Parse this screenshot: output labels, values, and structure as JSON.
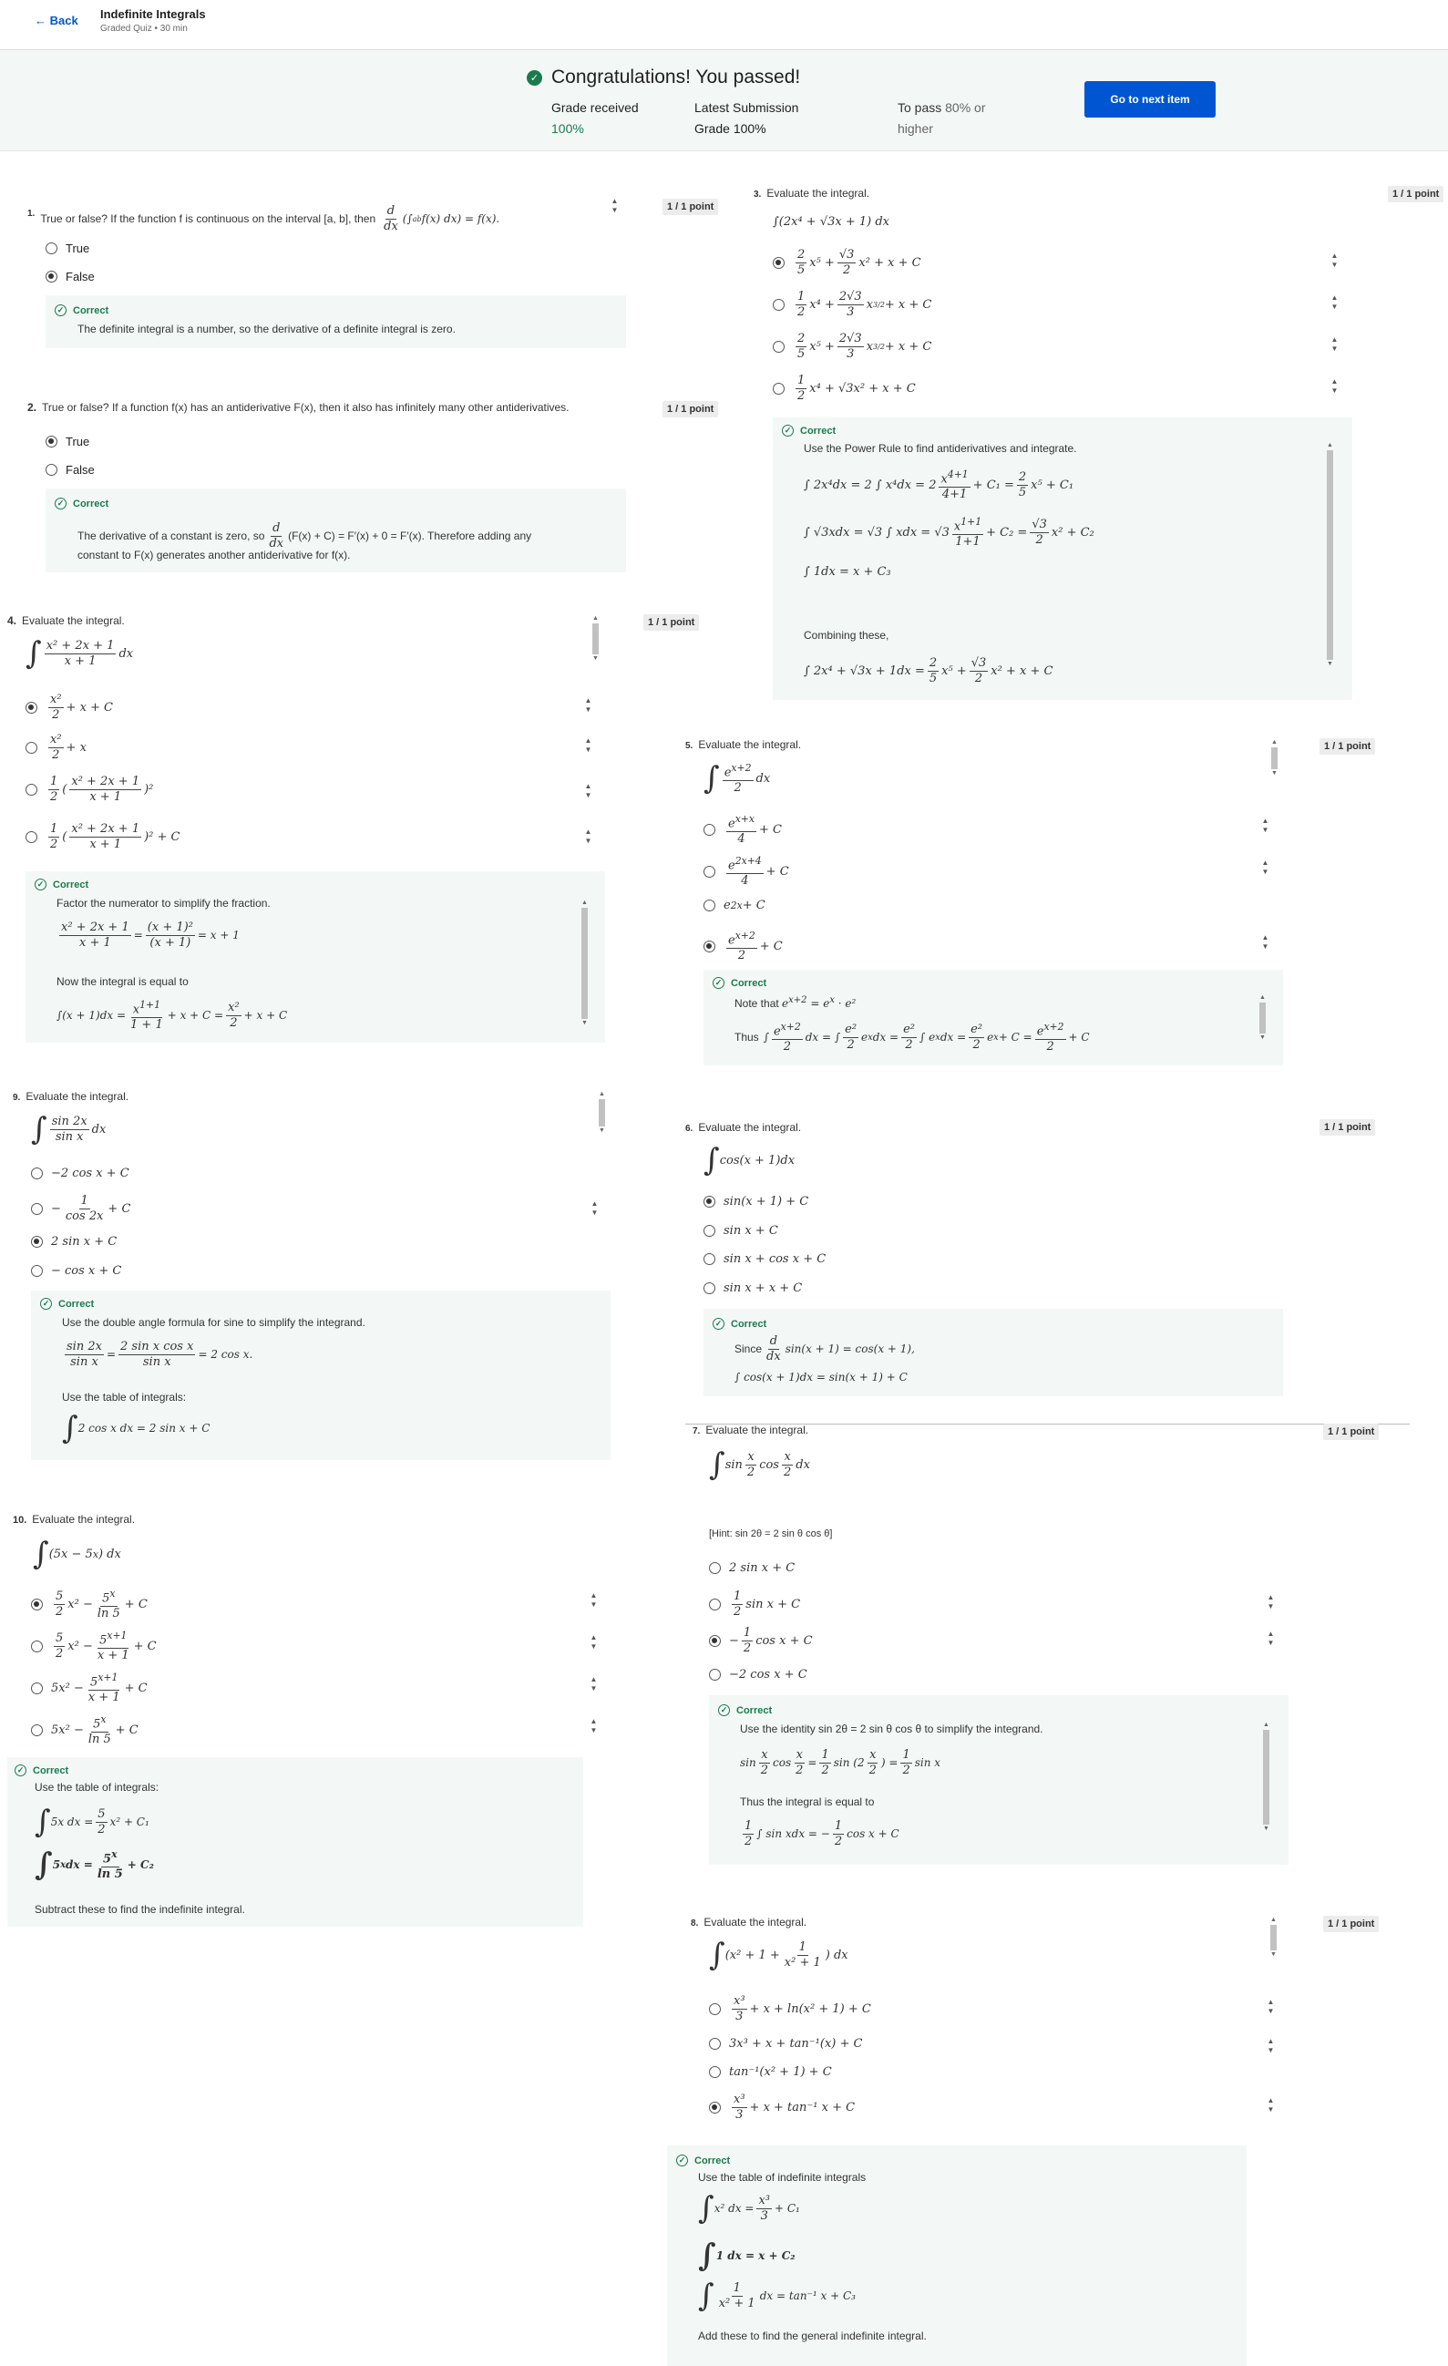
{
  "header": {
    "back_label": "Back",
    "title": "Indefinite Integrals",
    "subtitle": "Graded Quiz • 30 min"
  },
  "banner": {
    "title": "Congratulations! You passed!",
    "grade_label": "Grade received",
    "grade_value": "100%",
    "latest_label": "Latest Submission Grade",
    "latest_value": "100%",
    "topass_label": "To pass",
    "topass_value": "80% or higher",
    "next_button": "Go to next item"
  },
  "common": {
    "points": "1 / 1 point",
    "correct": "Correct",
    "evaluate": "Evaluate the integral."
  },
  "q1": {
    "num": "1.",
    "text": "True or false? If the function f is continuous on the interval [a, b], then",
    "options": [
      "True",
      "False"
    ],
    "selected": 1,
    "feedback": "The definite integral is a number, so the derivative of a definite integral is zero."
  },
  "q2": {
    "num": "2.",
    "text": "True or false? If a function f(x) has an antiderivative F(x), then it also has infinitely many other antiderivatives.",
    "options": [
      "True",
      "False"
    ],
    "selected": 0,
    "feedback_a": "The derivative of a constant is zero, so",
    "feedback_b": "(F(x) + C) = F′(x) + 0 = F′(x). Therefore adding any",
    "feedback_c": "constant to F(x) generates another antiderivative for f(x)."
  },
  "q3": {
    "num": "3.",
    "feedback": "Use the Power Rule to find antiderivatives and integrate.",
    "combining": "Combining these,"
  },
  "q4": {
    "num": "4.",
    "feedback": "Factor the numerator to simplify the fraction.",
    "feedback2": "Now the integral is equal to"
  },
  "q5": {
    "num": "5.",
    "feedback_note": "Note that",
    "feedback_thus": "Thus"
  },
  "q6": {
    "num": "6.",
    "feedback_since": "Since"
  },
  "q7": {
    "num": "7.",
    "hint": "[Hint: sin 2θ = 2 sin θ cos θ]",
    "feedback": "Use the identity sin 2θ = 2 sin θ cos θ to simplify the integrand.",
    "feedback2": "Thus the integral is equal to"
  },
  "q8": {
    "num": "8.",
    "feedback": "Use the table of indefinite integrals",
    "feedback2": "Add these to find the general indefinite integral."
  },
  "q9": {
    "num": "9.",
    "feedback": "Use the double angle formula for sine to simplify the integrand.",
    "feedback2": "Use the table of integrals:"
  },
  "q10": {
    "num": "10.",
    "feedback": "Use the table of integrals:",
    "feedback2": "Subtract these to find the indefinite integral."
  },
  "colors": {
    "accent": "#0056d2",
    "success": "#1b7a4e",
    "banner_bg": "#f3f8f6"
  }
}
